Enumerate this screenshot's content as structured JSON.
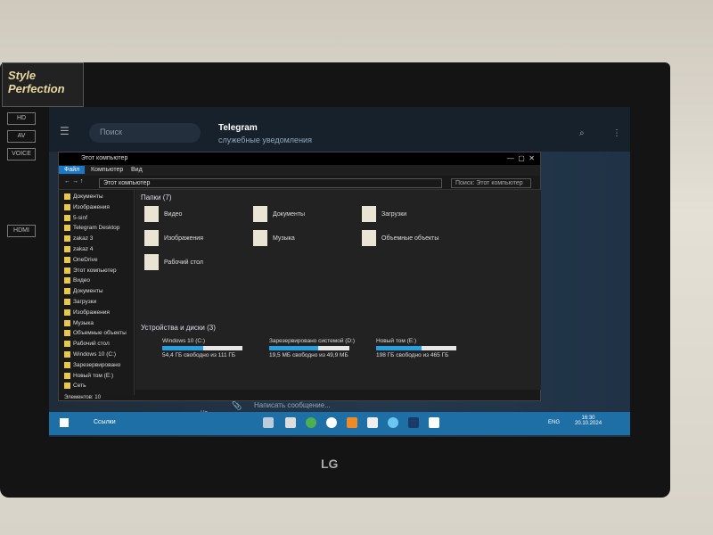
{
  "monitor": {
    "brand": "LG",
    "sticker": "Style Perfection",
    "badges": [
      "HD",
      "AV",
      "VOICE",
      "HDMI"
    ]
  },
  "telegram": {
    "search_placeholder": "Поиск",
    "chat_title": "Telegram",
    "chat_subtitle": "служебные уведомления",
    "message_placeholder": "Написать сообщение...",
    "day": "Чт"
  },
  "explorer": {
    "title": "Этот компьютер",
    "tabs": [
      "Файл",
      "Компьютер",
      "Вид"
    ],
    "address": "Этот компьютер",
    "search_placeholder": "Поиск: Этот компьютер",
    "nav": [
      "Документы",
      "Изображения",
      "5-sinf",
      "Telegram Desktop",
      "zakaz 3",
      "zakaz 4",
      "OneDrive",
      "Этот компьютер",
      "Видео",
      "Документы",
      "Загрузки",
      "Изображения",
      "Музыка",
      "Объемные объекты",
      "Рабочий стол",
      "Windows 10 (C:)",
      "Зарезервировано",
      "Новый том (E:)",
      "Сеть"
    ],
    "folders_header": "Папки (7)",
    "folders": [
      "Видео",
      "Документы",
      "Загрузки",
      "Изображения",
      "Музыка",
      "Объемные объекты",
      "Рабочий стол"
    ],
    "drives_header": "Устройства и диски (3)",
    "drives": [
      {
        "name": "Windows 10 (C:)",
        "free": "54,4 ГБ свободно из 111 ГБ",
        "used_pct": 51
      },
      {
        "name": "Зарезервировано системой (D:)",
        "free": "19,5 МБ свободно из 49,9 МБ",
        "used_pct": 61
      },
      {
        "name": "Новый том (E:)",
        "free": "198 ГБ свободно из 465 ГБ",
        "used_pct": 57
      }
    ],
    "status": "Элементов: 10"
  },
  "taskbar": {
    "search_label": "Ссылки",
    "lang": "ENG",
    "time": "16:30",
    "date": "20.10.2024",
    "accent": "#1d6fa5"
  }
}
